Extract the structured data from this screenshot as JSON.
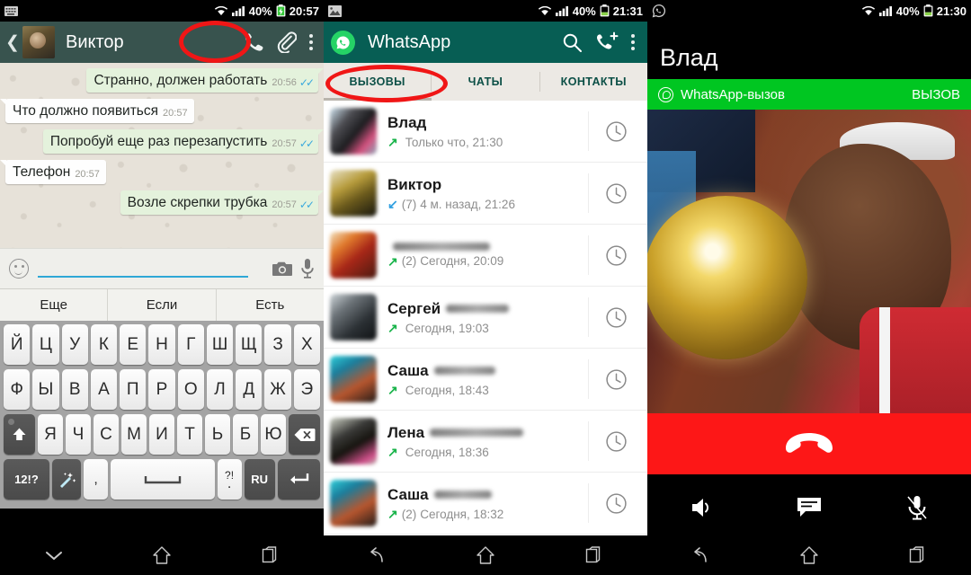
{
  "panels": {
    "chat": {
      "status_bar": {
        "left_icon": "keyboard-icon",
        "wifi": "wifi-icon",
        "signal": "signal-icon",
        "battery_pct": "40%",
        "battery_state": "charging",
        "time": "20:57"
      },
      "header": {
        "back": "back-arrow-icon",
        "avatar": "contact-avatar",
        "title": "Виктор",
        "call_icon": "phone-call-icon",
        "attach_icon": "paperclip-icon",
        "menu_icon": "overflow-menu-icon"
      },
      "messages": [
        {
          "dir": "out",
          "text": "Странно, должен работать",
          "time": "20:56",
          "status": "read"
        },
        {
          "dir": "in",
          "text": "Что должно появиться",
          "time": "20:57",
          "status": ""
        },
        {
          "dir": "out",
          "text": "Попробуй еще раз перезапустить",
          "time": "20:57",
          "status": "read"
        },
        {
          "dir": "in",
          "text": "Телефон",
          "time": "20:57",
          "status": ""
        },
        {
          "dir": "out",
          "text": "Возле скрепки трубка",
          "time": "20:57",
          "status": "read"
        }
      ],
      "input": {
        "emoji_icon": "emoji-icon",
        "value": "",
        "placeholder": "",
        "camera_icon": "camera-icon",
        "mic_icon": "microphone-icon"
      },
      "suggestions": [
        "Еще",
        "Если",
        "Есть"
      ],
      "keyboard": {
        "row1": [
          "Й",
          "Ц",
          "У",
          "К",
          "Е",
          "Н",
          "Г",
          "Ш",
          "Щ",
          "З",
          "Х"
        ],
        "row2": [
          "Ф",
          "Ы",
          "В",
          "А",
          "П",
          "Р",
          "О",
          "Л",
          "Д",
          "Ж",
          "Э"
        ],
        "row3": [
          "Я",
          "Ч",
          "С",
          "М",
          "И",
          "Т",
          "Ь",
          "Б",
          "Ю"
        ],
        "shift": "shift-icon",
        "backspace": "backspace-icon",
        "numeric": "12!?",
        "magic": "magic-wand-icon",
        "comma": ",",
        "space": "space-key",
        "period_top": "?!",
        "period": ".",
        "lang": "RU",
        "enter": "enter-icon"
      }
    },
    "whatsapp": {
      "status_bar": {
        "left_icon": "image-icon",
        "wifi": "wifi-icon",
        "signal": "signal-icon",
        "battery_pct": "40%",
        "battery_state": "normal",
        "time": "21:31"
      },
      "header": {
        "logo": "whatsapp-logo-icon",
        "title": "WhatsApp",
        "search_icon": "search-icon",
        "new_call_icon": "new-call-icon",
        "menu_icon": "overflow-menu-icon"
      },
      "tabs": [
        {
          "label": "ВЫЗОВЫ",
          "active": true
        },
        {
          "label": "ЧАТЫ",
          "active": false
        },
        {
          "label": "КОНТАКТЫ",
          "active": false
        }
      ],
      "calls": [
        {
          "name": "Влад",
          "redact_w": 0,
          "dir": "out",
          "count": "",
          "time": "Только что, 21:30",
          "info_icon": "call-info-icon",
          "av": "av1"
        },
        {
          "name": "Виктор",
          "redact_w": 0,
          "dir": "in",
          "count": "(7)",
          "time": "4 м. назад, 21:26",
          "info_icon": "call-info-icon",
          "av": "av2"
        },
        {
          "name": "",
          "redact_w": 108,
          "dir": "out",
          "count": "(2)",
          "time": "Сегодня, 20:09",
          "info_icon": "call-info-icon",
          "av": "av3"
        },
        {
          "name": "Сергей",
          "redact_w": 70,
          "dir": "out",
          "count": "",
          "time": "Сегодня, 19:03",
          "info_icon": "call-info-icon",
          "av": "av4"
        },
        {
          "name": "Саша",
          "redact_w": 68,
          "dir": "out",
          "count": "",
          "time": "Сегодня, 18:43",
          "info_icon": "call-info-icon",
          "av": "av5"
        },
        {
          "name": "Лена",
          "redact_w": 104,
          "dir": "out",
          "count": "",
          "time": "Сегодня, 18:36",
          "info_icon": "call-info-icon",
          "av": "av6"
        },
        {
          "name": "Саша",
          "redact_w": 64,
          "dir": "out",
          "count": "(2)",
          "time": "Сегодня, 18:32",
          "info_icon": "call-info-icon",
          "av": "av5"
        }
      ]
    },
    "call": {
      "status_bar": {
        "left_icon": "whatsapp-notification-icon",
        "wifi": "wifi-icon",
        "signal": "signal-icon",
        "battery_pct": "40%",
        "battery_state": "normal",
        "time": "21:30"
      },
      "contact_name": "Влад",
      "banner": {
        "logo": "whatsapp-logo-icon",
        "label": "WhatsApp-вызов",
        "action": "ВЫЗОВ"
      },
      "photo_alt": "contact-photo",
      "hangup_icon": "end-call-icon",
      "actions": [
        {
          "icon": "speaker-icon"
        },
        {
          "icon": "chat-message-icon"
        },
        {
          "icon": "mute-microphone-icon"
        }
      ]
    }
  },
  "navbar": [
    {
      "icon": "hide-keyboard-icon"
    },
    {
      "icon": "home-icon"
    },
    {
      "icon": "recents-icon"
    },
    {
      "icon": "back-icon"
    },
    {
      "icon": "home-icon"
    },
    {
      "icon": "recents-icon"
    },
    {
      "icon": "back-icon"
    },
    {
      "icon": "home-icon"
    },
    {
      "icon": "recents-icon"
    }
  ],
  "annotations": [
    {
      "name": "highlight-call-button"
    },
    {
      "name": "highlight-calls-tab"
    }
  ],
  "colors": {
    "whatsapp_header": "#075e54",
    "chat_header": "#38534e",
    "bubble_out": "#e4f2dc",
    "bubble_in": "#ffffff",
    "tick_blue": "#39a9dd",
    "call_banner_green": "#00c621",
    "hangup_red": "#fd1717",
    "annotation_red": "#f01616",
    "arrow_out_green": "#19b34a",
    "arrow_in_blue": "#2f9fe0"
  }
}
